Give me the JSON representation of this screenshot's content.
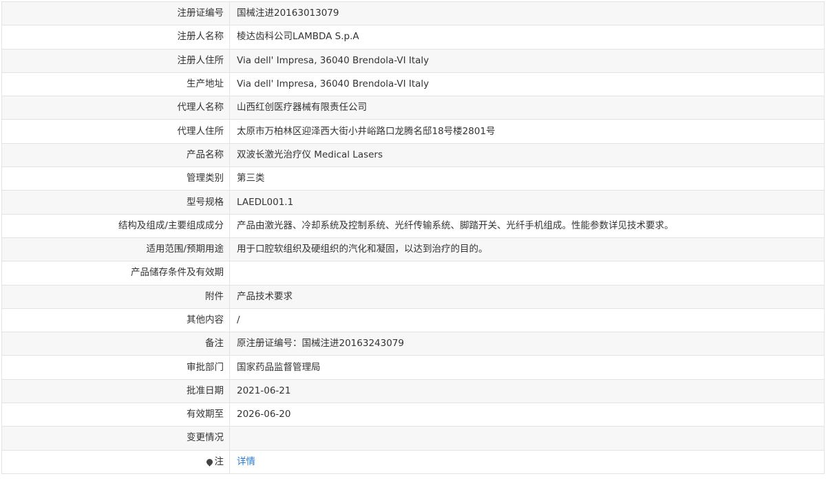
{
  "rows": [
    {
      "label": "注册证编号",
      "value": "国械注进20163013079"
    },
    {
      "label": "注册人名称",
      "value": "棱达齿科公司LAMBDA S.p.A"
    },
    {
      "label": "注册人住所",
      "value": "Via dell' Impresa, 36040 Brendola-VI Italy"
    },
    {
      "label": "生产地址",
      "value": "Via dell' Impresa, 36040 Brendola-VI Italy"
    },
    {
      "label": "代理人名称",
      "value": "山西红创医疗器械有限责任公司"
    },
    {
      "label": "代理人住所",
      "value": "太原市万柏林区迎泽西大街小井峪路口龙腾名邸18号楼2801号"
    },
    {
      "label": "产品名称",
      "value": "双波长激光治疗仪 Medical Lasers"
    },
    {
      "label": "管理类别",
      "value": "第三类"
    },
    {
      "label": "型号规格",
      "value": "LAEDL001.1"
    },
    {
      "label": "结构及组成/主要组成成分",
      "value": "产品由激光器、冷却系统及控制系统、光纤传输系统、脚踏开关、光纤手机组成。性能参数详见技术要求。"
    },
    {
      "label": "适用范围/预期用途",
      "value": "用于口腔软组织及硬组织的汽化和凝固，以达到治疗的目的。"
    },
    {
      "label": "产品储存条件及有效期",
      "value": ""
    },
    {
      "label": "附件",
      "value": "产品技术要求"
    },
    {
      "label": "其他内容",
      "value": "/"
    },
    {
      "label": "备注",
      "value": "原注册证编号：国械注进20163243079"
    },
    {
      "label": "审批部门",
      "value": "国家药品监督管理局"
    },
    {
      "label": "批准日期",
      "value": "2021-06-21"
    },
    {
      "label": "有效期至",
      "value": "2026-06-20"
    },
    {
      "label": "变更情况",
      "value": ""
    }
  ],
  "note_row": {
    "icon": "map-pin-icon",
    "label": "注",
    "link_text": "详情"
  },
  "colors": {
    "link": "#2a7bd1",
    "row_alt": "#f7f7f7",
    "border": "#e3e3e3"
  }
}
